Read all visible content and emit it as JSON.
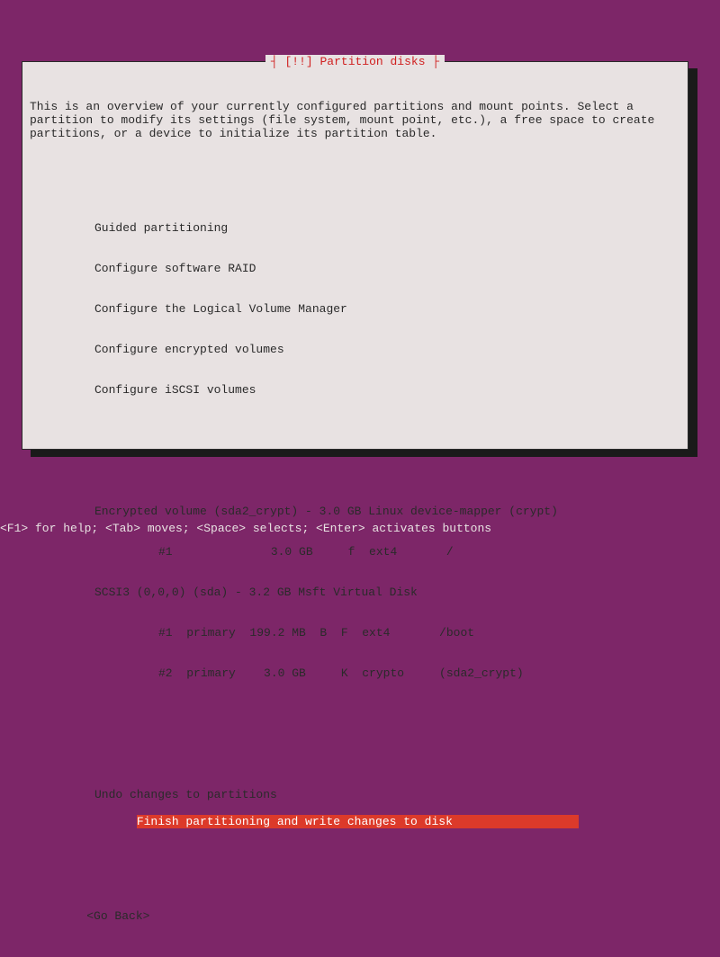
{
  "title": "┤ [!!] Partition disks ├",
  "description": "This is an overview of your currently configured partitions and mount points. Select a partition to modify its settings (file system, mount point, etc.), a free space to create partitions, or a device to initialize its partition table.",
  "menu1": {
    "guided": "Guided partitioning",
    "raid": "Configure software RAID",
    "lvm": "Configure the Logical Volume Manager",
    "encrypted": "Configure encrypted volumes",
    "iscsi": "Configure iSCSI volumes"
  },
  "disks": {
    "encvol": "Encrypted volume (sda2_crypt) - 3.0 GB Linux device-mapper (crypt)",
    "encvol_p1": "     #1              3.0 GB     f  ext4       /",
    "scsi": "SCSI3 (0,0,0) (sda) - 3.2 GB Msft Virtual Disk",
    "scsi_p1": "     #1  primary  199.2 MB  B  F  ext4       /boot",
    "scsi_p2": "     #2  primary    3.0 GB     K  crypto     (sda2_crypt)"
  },
  "menu2": {
    "undo": "Undo changes to partitions",
    "finish": "Finish partitioning and write changes to disk"
  },
  "goback": "    <Go Back>",
  "footer": "<F1> for help; <Tab> moves; <Space> selects; <Enter> activates buttons"
}
